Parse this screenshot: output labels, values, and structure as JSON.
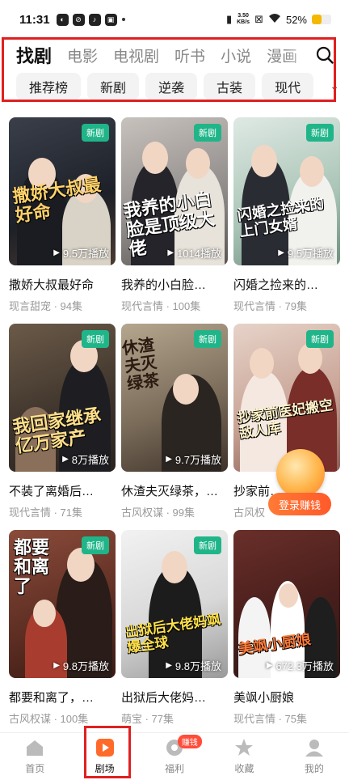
{
  "status_bar": {
    "time": "11:31",
    "speed_value": "3.50",
    "speed_unit": "KB/s",
    "battery": "52%",
    "battery_level": 0.52
  },
  "category_tabs": [
    "找剧",
    "电影",
    "电视剧",
    "听书",
    "小说",
    "漫画"
  ],
  "active_tab_index": 0,
  "filter_chips": [
    "推荐榜",
    "新剧",
    "逆袭",
    "古装",
    "现代"
  ],
  "badge_label": "新剧",
  "dramas": [
    {
      "poster_title": "撒娇大叔最好命",
      "plays": "9.5万播放",
      "title": "撒娇大叔最好命",
      "meta": "现言甜宠 · 94集"
    },
    {
      "poster_title": "我养的小白脸是顶级大佬",
      "plays": "1014播放",
      "title": "我养的小白脸…",
      "meta": "现代言情 · 100集"
    },
    {
      "poster_title": "闪婚之捡来的上门女婿",
      "plays": "9.5万播放",
      "title": "闪婚之捡来的…",
      "meta": "现代言情 · 79集"
    },
    {
      "poster_title": "我回家继承亿万家产",
      "plays": "8万播放",
      "title": "不装了离婚后…",
      "meta": "现代言情 · 71集"
    },
    {
      "poster_title": "休渣夫灭绿茶",
      "plays": "9.7万播放",
      "title": "休渣夫灭绿茶，…",
      "meta": "古风权谋 · 99集"
    },
    {
      "poster_title": "抄家前医妃搬空敌人库",
      "plays": "",
      "title": "抄家前…",
      "meta": "古风权"
    },
    {
      "poster_title": "都要和离了",
      "plays": "9.8万播放",
      "title": "都要和离了，…",
      "meta": "古风权谋 · 100集"
    },
    {
      "poster_title": "出狱后大佬妈飒爆全球",
      "plays": "9.8万播放",
      "title": "出狱后大佬妈…",
      "meta": "萌宝 · 77集"
    },
    {
      "poster_title": "美飒小厨娘",
      "plays": "672.3万播放",
      "title": "美飒小厨娘",
      "meta": "现代言情 · 75集"
    }
  ],
  "reward": {
    "label": "登录赚钱"
  },
  "bottom_nav": {
    "items": [
      "首页",
      "剧场",
      "福利",
      "收藏",
      "我的"
    ],
    "active_index": 1,
    "welfare_badge": "赚钱"
  },
  "colors": {
    "accent": "#20b589",
    "highlight": "#e02020",
    "reward": "#ff5a2a",
    "nav_active": "#ff6a2a"
  }
}
